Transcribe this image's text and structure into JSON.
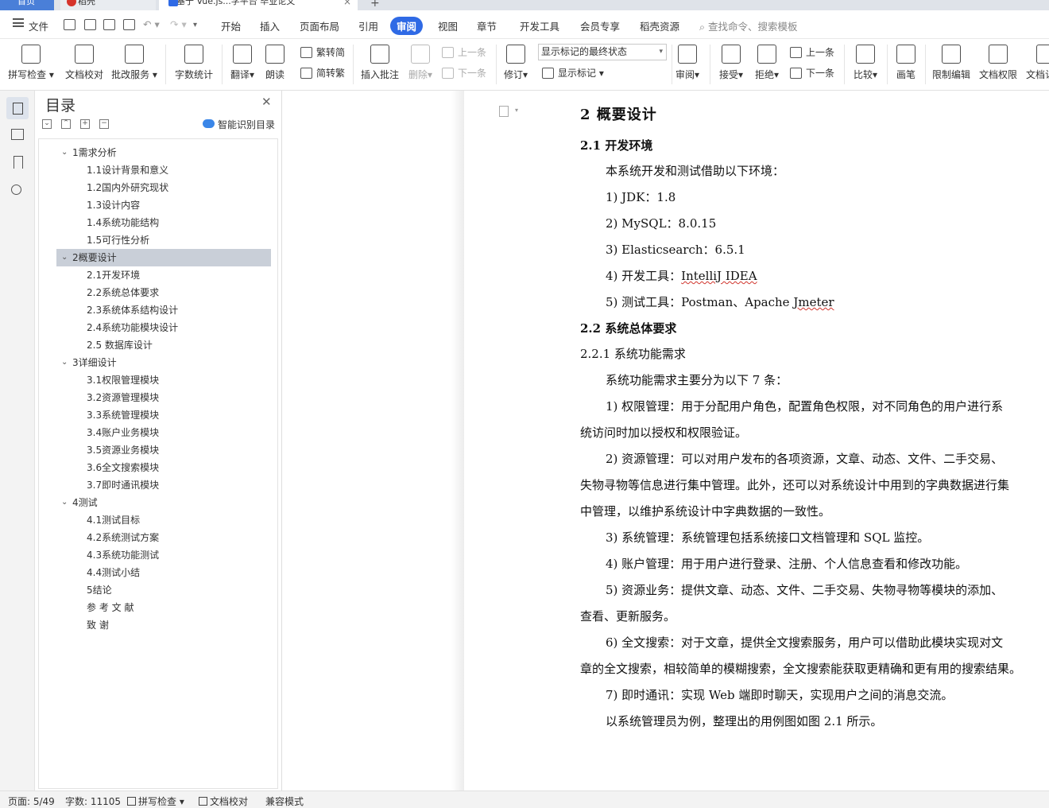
{
  "tabs": {
    "home": "首页",
    "daoke": "稻壳",
    "doc": "基于 Vue.js...学平台 毕业论文"
  },
  "menu": {
    "file": "文件",
    "items": [
      "开始",
      "插入",
      "页面布局",
      "引用",
      "审阅",
      "视图",
      "章节",
      "开发工具",
      "会员专享",
      "稻壳资源"
    ],
    "active": "审阅",
    "search_placeholder": "查找命令、搜索模板"
  },
  "ribbon": {
    "spell_check": "拼写检查",
    "doc_proof": "文档校对",
    "batch_service": "批改服务",
    "word_count": "字数统计",
    "translate": "翻译",
    "read_aloud": "朗读",
    "trad_to_simp": "繁转简",
    "simp_to_trad": "简转繁",
    "insert_comment": "插入批注",
    "delete": "删除",
    "prev_comment": "上一条",
    "next_comment": "下一条",
    "revise": "修订",
    "markup_state": "显示标记的最终状态",
    "show_markup": "显示标记",
    "review": "审阅",
    "accept": "接受",
    "reject": "拒绝",
    "prev_change": "上一条",
    "next_change": "下一条",
    "compare": "比较",
    "pen": "画笔",
    "restrict_edit": "限制编辑",
    "doc_permission": "文档权限",
    "doc_more": "文档认"
  },
  "toc": {
    "title": "目录",
    "smart_toc": "智能识别目录",
    "items": [
      {
        "level": 1,
        "text": "1需求分析",
        "expanded": true
      },
      {
        "level": 2,
        "text": "1.1设计背景和意义"
      },
      {
        "level": 2,
        "text": "1.2国内外研究现状"
      },
      {
        "level": 2,
        "text": "1.3设计内容"
      },
      {
        "level": 2,
        "text": "1.4系统功能结构"
      },
      {
        "level": 2,
        "text": "1.5可行性分析"
      },
      {
        "level": 1,
        "text": "2概要设计",
        "expanded": true,
        "selected": true
      },
      {
        "level": 2,
        "text": "2.1开发环境"
      },
      {
        "level": 2,
        "text": "2.2系统总体要求"
      },
      {
        "level": 2,
        "text": "2.3系统体系结构设计"
      },
      {
        "level": 2,
        "text": "2.4系统功能模块设计"
      },
      {
        "level": 2,
        "text": "2.5  数据库设计"
      },
      {
        "level": 1,
        "text": "3详细设计",
        "expanded": true
      },
      {
        "level": 2,
        "text": "3.1权限管理模块"
      },
      {
        "level": 2,
        "text": "3.2资源管理模块"
      },
      {
        "level": 2,
        "text": "3.3系统管理模块"
      },
      {
        "level": 2,
        "text": "3.4账户业务模块"
      },
      {
        "level": 2,
        "text": "3.5资源业务模块"
      },
      {
        "level": 2,
        "text": "3.6全文搜索模块"
      },
      {
        "level": 2,
        "text": "3.7即时通讯模块"
      },
      {
        "level": 1,
        "text": "4测试",
        "expanded": true
      },
      {
        "level": 2,
        "text": "4.1测试目标"
      },
      {
        "level": 2,
        "text": "4.2系统测试方案"
      },
      {
        "level": 2,
        "text": "4.3系统功能测试"
      },
      {
        "level": 2,
        "text": "4.4测试小结"
      },
      {
        "level": 1,
        "text": "5结论",
        "leaf": true
      },
      {
        "level": 1,
        "text": "参 考 文 献",
        "leaf": true
      },
      {
        "level": 1,
        "text": "致  谢",
        "leaf": true
      }
    ]
  },
  "document": {
    "h1": "2    概要设计",
    "h2_1": "2.1    开发环境",
    "env_intro": "本系统开发和测试借助以下环境：",
    "env_items": [
      "1)  JDK：1.8",
      "2)  MySQL：8.0.15",
      "3)  Elasticsearch：6.5.1",
      "4)  开发工具：",
      "5)  测试工具：Postman、Apache "
    ],
    "env4_tool": "IntelliJ IDEA",
    "env5_tool": "Jmeter",
    "h2_2": "2.2    系统总体要求",
    "h3_1": "2.2.1    系统功能需求",
    "req_intro": "系统功能需求主要分为以下  7 条：",
    "lines": [
      {
        "indent": true,
        "text": "1)  权限管理：用于分配用户角色，配置角色权限，对不同角色的用户进行系"
      },
      {
        "indent": false,
        "text": "统访问时加以授权和权限验证。"
      },
      {
        "indent": true,
        "text": "2)  资源管理：可以对用户发布的各项资源，文章、动态、文件、二手交易、"
      },
      {
        "indent": false,
        "text": "失物寻物等信息进行集中管理。此外，还可以对系统设计中用到的字典数据进行集"
      },
      {
        "indent": false,
        "text": "中管理，以维护系统设计中字典数据的一致性。"
      },
      {
        "indent": true,
        "text": "3)  系统管理：系统管理包括系统接口文档管理和  SQL 监控。"
      },
      {
        "indent": true,
        "text": "4)  账户管理：用于用户进行登录、注册、个人信息查看和修改功能。"
      },
      {
        "indent": true,
        "text": "5)  资源业务：提供文章、动态、文件、二手交易、失物寻物等模块的添加、"
      },
      {
        "indent": false,
        "text": "查看、更新服务。"
      },
      {
        "indent": true,
        "text": "6)  全文搜索：对于文章，提供全文搜索服务，用户可以借助此模块实现对文"
      },
      {
        "indent": false,
        "text": "章的全文搜索，相较简单的模糊搜索，全文搜索能获取更精确和更有用的搜索结果。"
      },
      {
        "indent": true,
        "text": "7)  即时通讯：实现  Web 端即时聊天，实现用户之间的消息交流。"
      },
      {
        "indent": true,
        "text": "以系统管理员为例，整理出的用例图如图  2.1 所示。"
      }
    ]
  },
  "status": {
    "page": "页面: 5/49",
    "words": "字数: 11105",
    "spell": "拼写检查",
    "proof": "文档校对",
    "compat": "兼容模式"
  }
}
